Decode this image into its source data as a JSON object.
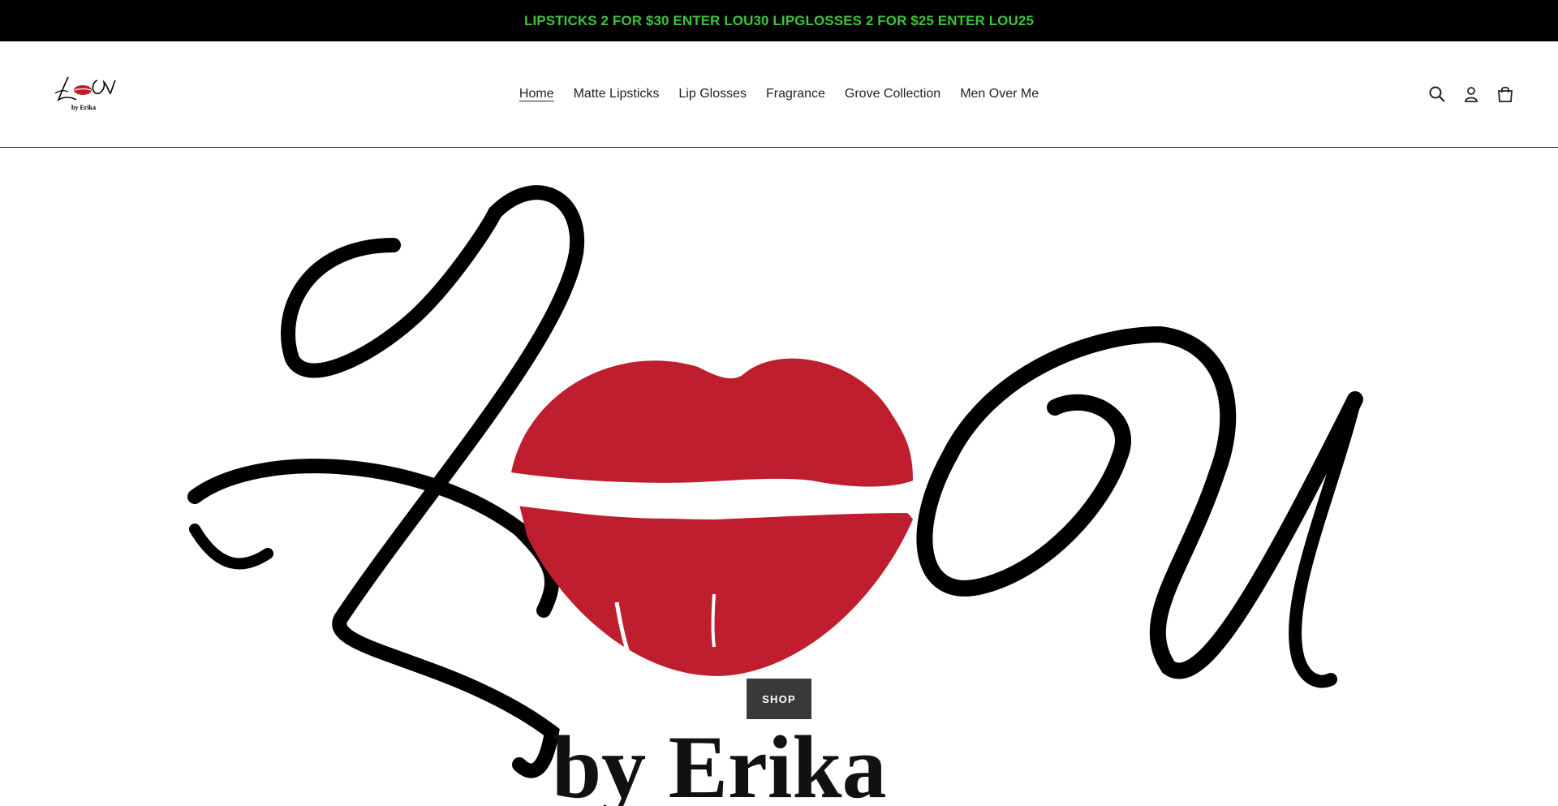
{
  "announcement": {
    "text": "LIPSTICKS 2 FOR $30 ENTER LOU30 LIPGLOSSES 2 FOR $25 ENTER LOU25",
    "color": "#3cc43c"
  },
  "header": {
    "logo_text": "LoU",
    "logo_subtext": "by Erika",
    "nav": [
      {
        "label": "Home",
        "active": true
      },
      {
        "label": "Matte Lipsticks"
      },
      {
        "label": "Lip Glosses"
      },
      {
        "label": "Fragrance"
      },
      {
        "label": "Grove Collection"
      },
      {
        "label": "Men Over Me"
      }
    ],
    "icons": [
      "search-icon",
      "account-icon",
      "cart-icon"
    ]
  },
  "hero": {
    "brand_subtext": "by Erika",
    "lips_color": "#bf1e2e",
    "button_label": "SHOP"
  }
}
